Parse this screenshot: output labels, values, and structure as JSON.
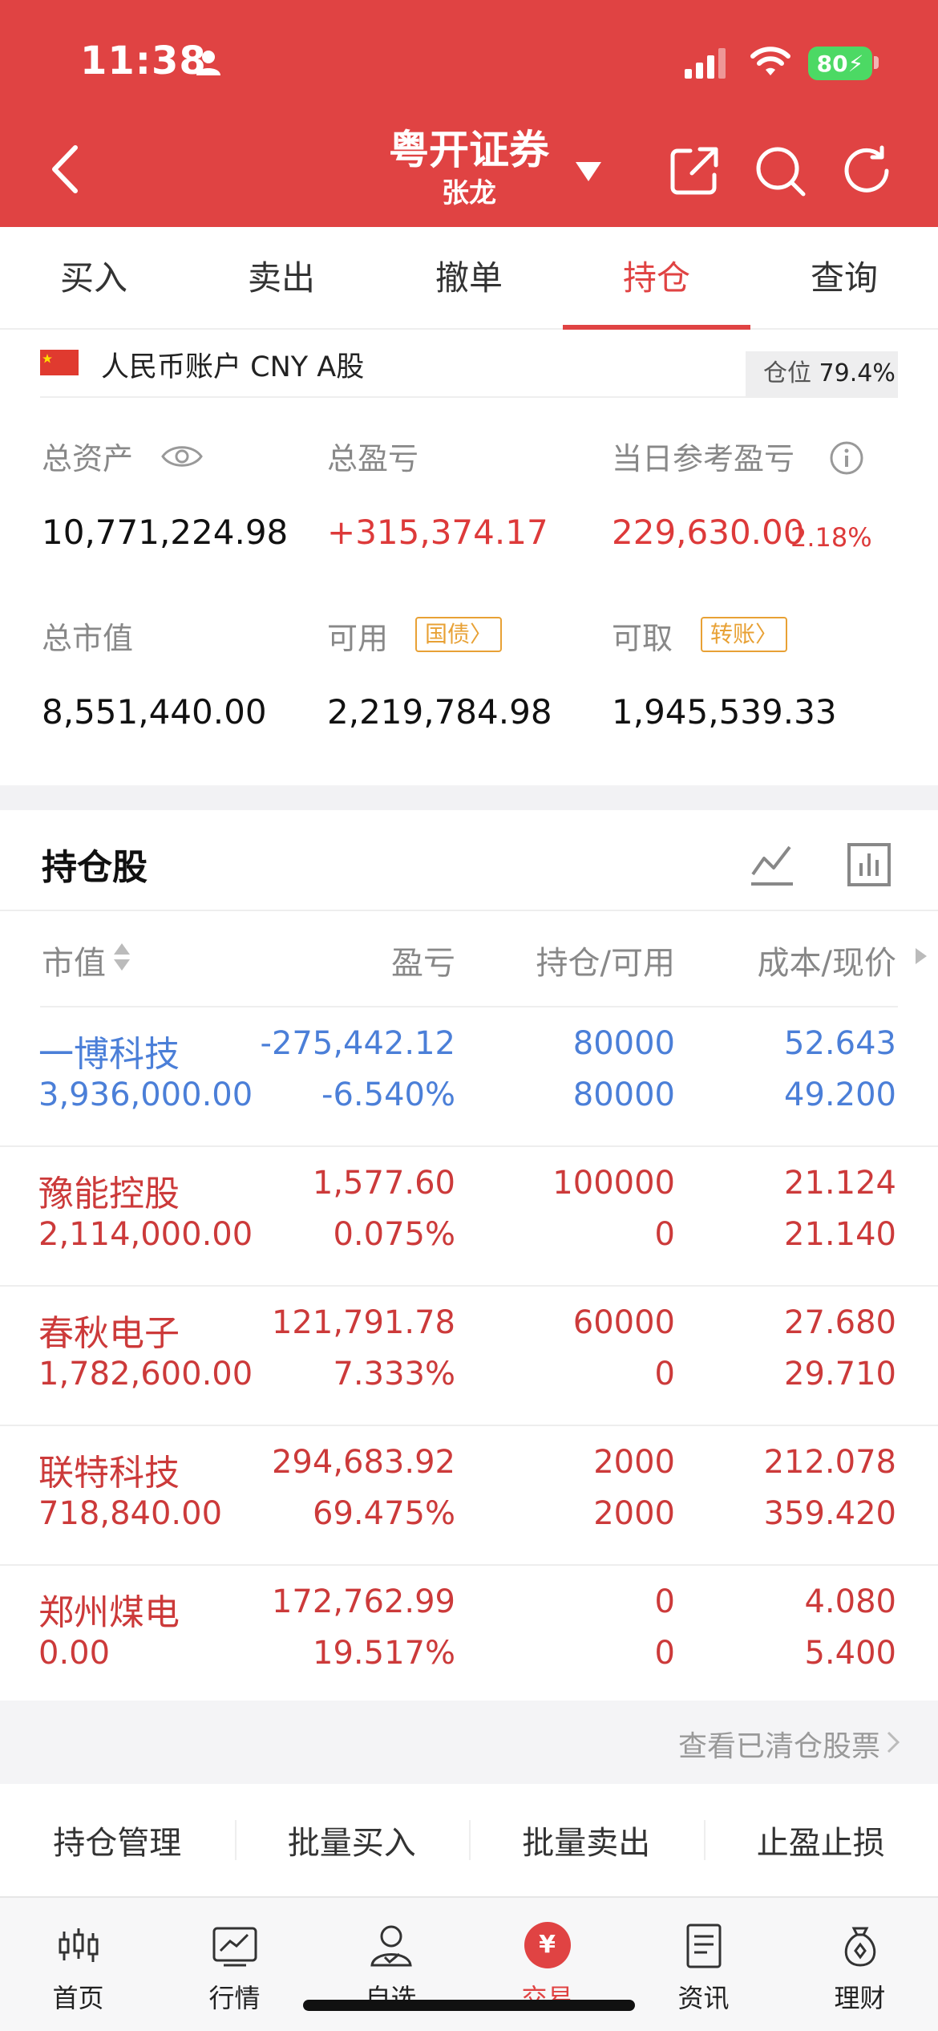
{
  "status_bar": {
    "time": "11:38",
    "battery": "80"
  },
  "header": {
    "broker": "粤开证券",
    "account_holder": "张龙"
  },
  "tabs": [
    {
      "label": "买入",
      "active": false
    },
    {
      "label": "卖出",
      "active": false
    },
    {
      "label": "撤单",
      "active": false
    },
    {
      "label": "持仓",
      "active": true
    },
    {
      "label": "查询",
      "active": false
    }
  ],
  "account": {
    "label": "人民币账户 CNY A股",
    "position_label": "仓位",
    "position_value": "79.4%",
    "total_assets_label": "总资产",
    "total_assets": "10,771,224.98",
    "total_pl_label": "总盈亏",
    "total_pl": "+315,374.17",
    "daily_pl_label": "当日参考盈亏",
    "daily_pl": "229,630.00",
    "daily_pl_pct": "2.18%",
    "market_value_label": "总市值",
    "market_value": "8,551,440.00",
    "available_label": "可用",
    "available_tag": "国债",
    "available": "2,219,784.98",
    "withdrawable_label": "可取",
    "withdrawable_tag": "转账",
    "withdrawable": "1,945,539.33"
  },
  "holdings": {
    "title": "持仓股",
    "columns": {
      "mv": "市值",
      "pl": "盈亏",
      "hold": "持仓/可用",
      "cost": "成本/现价"
    },
    "rows": [
      {
        "name": "一博科技",
        "mv": "3,936,000.00",
        "pl": "-275,442.12",
        "plp": "-6.540%",
        "hold": "80000",
        "avail": "80000",
        "cost": "52.643",
        "price": "49.200",
        "trend": "down"
      },
      {
        "name": "豫能控股",
        "mv": "2,114,000.00",
        "pl": "1,577.60",
        "plp": "0.075%",
        "hold": "100000",
        "avail": "0",
        "cost": "21.124",
        "price": "21.140",
        "trend": "up"
      },
      {
        "name": "春秋电子",
        "mv": "1,782,600.00",
        "pl": "121,791.78",
        "plp": "7.333%",
        "hold": "60000",
        "avail": "0",
        "cost": "27.680",
        "price": "29.710",
        "trend": "up"
      },
      {
        "name": "联特科技",
        "mv": "718,840.00",
        "pl": "294,683.92",
        "plp": "69.475%",
        "hold": "2000",
        "avail": "2000",
        "cost": "212.078",
        "price": "359.420",
        "trend": "up"
      },
      {
        "name": "郑州煤电",
        "mv": "0.00",
        "pl": "172,762.99",
        "plp": "19.517%",
        "hold": "0",
        "avail": "0",
        "cost": "4.080",
        "price": "5.400",
        "trend": "up"
      }
    ],
    "cleared_link": "查看已清仓股票"
  },
  "actions": [
    "持仓管理",
    "批量买入",
    "批量卖出",
    "止盈止损"
  ],
  "tabbar": [
    {
      "label": "首页",
      "icon": "candlestick-icon",
      "active": false
    },
    {
      "label": "行情",
      "icon": "market-chart-icon",
      "active": false
    },
    {
      "label": "自选",
      "icon": "watchlist-user-icon",
      "active": false
    },
    {
      "label": "交易",
      "icon": "trade-yuan-icon",
      "active": true
    },
    {
      "label": "资讯",
      "icon": "news-doc-icon",
      "active": false
    },
    {
      "label": "理财",
      "icon": "wealth-bag-icon",
      "active": false
    }
  ],
  "colors": {
    "brand_red": "#e04343",
    "loss_blue": "#4b7fd8",
    "tag_orange": "#e8a135"
  }
}
